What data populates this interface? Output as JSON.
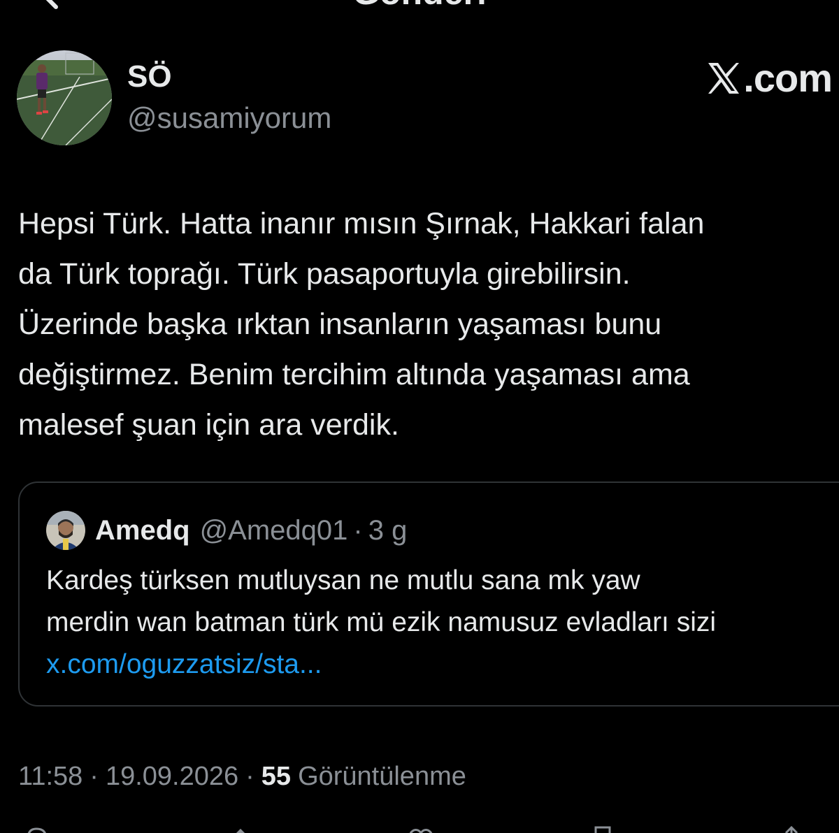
{
  "header": {
    "title": "Gönderi",
    "back_icon": "back-arrow-icon"
  },
  "author": {
    "display_name": "SÖ",
    "handle": "@susamiyorum",
    "avatar_icon": "avatar-photo"
  },
  "brand": {
    "domain": ".com",
    "logo_icon": "x-logo-icon"
  },
  "tweet": {
    "lines": [
      "Hepsi Türk. Hatta inanır mısın Şırnak, Hakkari falan",
      "da Türk toprağı. Türk pasaportuyla girebilirsin.",
      "Üzerinde başka ırktan insanların yaşaması bunu",
      "değiştirmez. Benim tercihim altında yaşaması ama",
      "malesef şuan için ara verdik."
    ]
  },
  "quote": {
    "display_name": "Amedq",
    "handle": "@Amedq01",
    "separator": "·",
    "time": "3 g",
    "lines": [
      "Kardeş türksen mutluysan ne mutlu sana mk yaw",
      "merdin wan batman türk mü ezik namusuz evladları sizi"
    ],
    "link": "x.com/oguzzatsiz/sta..."
  },
  "meta": {
    "time": "11:58",
    "separator": "·",
    "date": "19.09.2026",
    "views_count": "55",
    "views_label": "Görüntülenme"
  },
  "actions": {
    "icons": [
      "reply-icon",
      "retweet-icon",
      "like-icon",
      "bookmark-icon",
      "share-icon"
    ]
  },
  "colors": {
    "background": "#000000",
    "text_primary": "#e7e9ea",
    "text_secondary": "#8b9096",
    "link": "#1d9bf0",
    "border": "#2f3336"
  }
}
